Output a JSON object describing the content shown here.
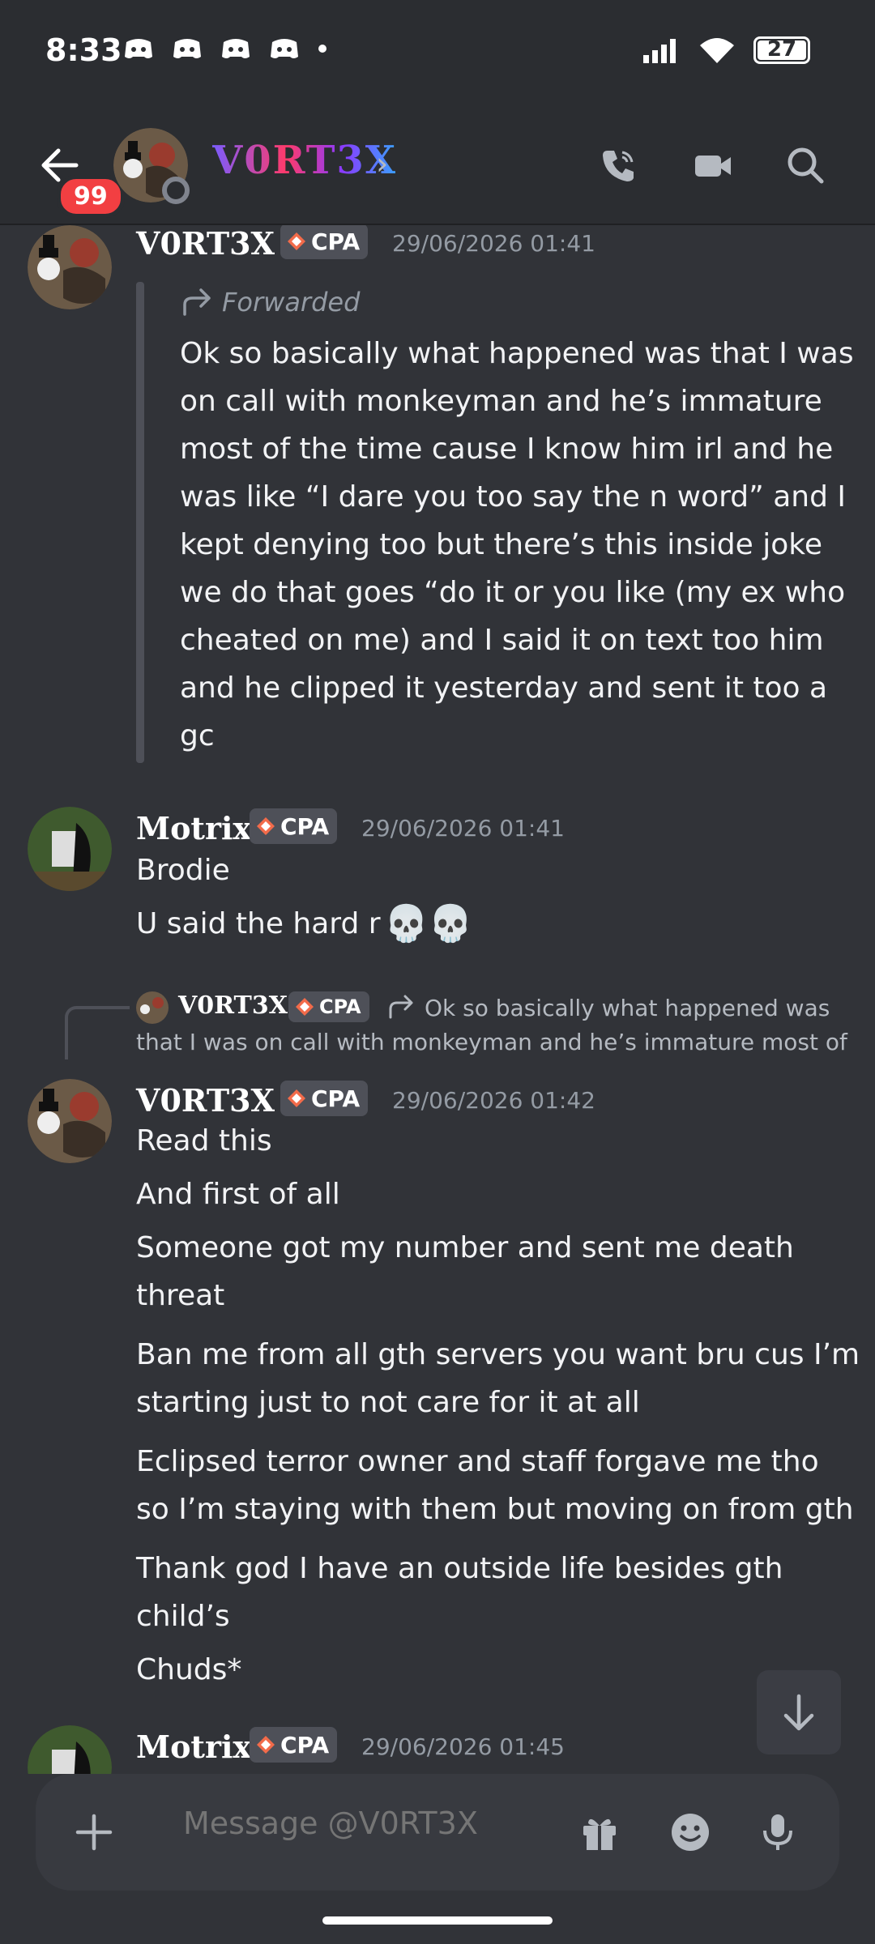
{
  "status_bar": {
    "time": "8:33",
    "battery": "27"
  },
  "header": {
    "badge": "99",
    "channel_name": "V0RT3X",
    "chevron": "›"
  },
  "messages": [
    {
      "author": "V0RT3X",
      "tag": "CPA",
      "timestamp": "29/06/2026 01:41",
      "forward_label": "Forwarded",
      "lines": [
        "Ok so basically what happened was that I was",
        "on call with monkeyman and he’s immature",
        "most of the time cause I know him irl and he",
        "was like “I dare you too say the n word” and I",
        "kept denying too but there’s this inside joke",
        "we do that goes “do it or you like (my ex who",
        "cheated on me) and I said it on text too him",
        "and he clipped it yesterday and sent it too a",
        "gc"
      ]
    },
    {
      "author": "Motrix",
      "tag": "CPA",
      "timestamp": "29/06/2026 01:41",
      "lines": [
        "Brodie",
        "U said the hard r"
      ],
      "emoji": "💀💀"
    },
    {
      "reply": {
        "author": "V0RT3X",
        "tag": "CPA",
        "line1": "Ok so basically what happened was",
        "line2": "that I was on call with monkeyman and he’s immature most of"
      },
      "author": "V0RT3X",
      "tag": "CPA",
      "timestamp": "29/06/2026 01:42",
      "lines": [
        "Read this",
        "And first of all",
        "Someone got my number and sent me death",
        "threat",
        "Ban me from all gth servers you want bru cus I’m",
        "starting just to not care for it at all",
        "Eclipsed terror owner and staff forgave me tho",
        "so I’m staying with them but moving on from gth",
        "Thank god I have an outside life besides gth",
        "child’s",
        "Chuds*"
      ]
    },
    {
      "author": "Motrix",
      "tag": "CPA",
      "timestamp": "29/06/2026 01:45"
    }
  ],
  "composer": {
    "placeholder": "Message @V0RT3X"
  },
  "colors": {
    "background": "#313338",
    "header": "#2b2d31",
    "badge": "#f23f42",
    "muted": "#949ba4"
  }
}
